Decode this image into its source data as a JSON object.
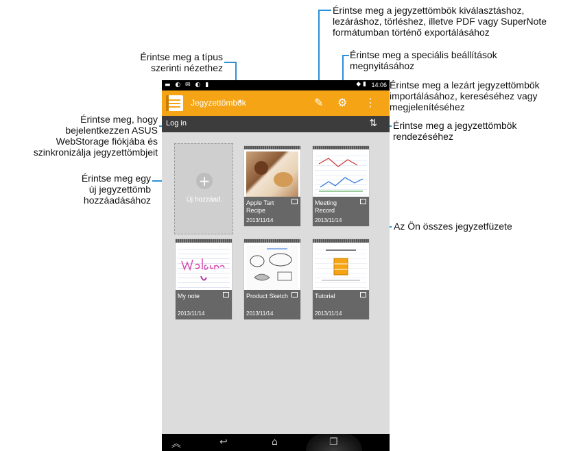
{
  "annotations": {
    "select": [
      "Érintse meg a jegyzettömbök kiválasztáshoz,",
      "lezáráshoz, törléshez, illetve PDF vagy SuperNote",
      "formátumban történő exportálásához"
    ],
    "settings": [
      "Érintse meg a speciális beállítások",
      "megnyitásához"
    ],
    "type_view": [
      "Érintse meg a típus",
      "szerinti nézethez"
    ],
    "locked": [
      "Érintse meg a lezárt jegyzettömbök",
      "importálásához, kereséséhez vagy",
      "megjelenítéséhez"
    ],
    "sort": [
      "Érintse meg a jegyzettömbök",
      "rendezéséhez"
    ],
    "login": [
      "Érintse meg, hogy",
      "bejelentkezzen ASUS",
      "WebStorage fiókjába és",
      "szinkronizálja jegyzettömbjeit"
    ],
    "add": [
      "Érintse meg egy",
      "új jegyzettömb",
      "hozzáadásához"
    ],
    "all": [
      "Az Ön összes jegyzetfüzete"
    ]
  },
  "device": {
    "status_time": "14:06",
    "view_title": "Jegyzettömbök",
    "login_label": "Log in",
    "add_label": "Új hozzáad.",
    "notebooks": [
      {
        "title": "Apple Tart Recipe",
        "date": "2013/11/14"
      },
      {
        "title": "Meeting Record",
        "date": "2013/11/14"
      },
      {
        "title": "My note",
        "date": "2013/11/14"
      },
      {
        "title": "Product Sketch",
        "date": "2013/11/14"
      },
      {
        "title": "Tutorial",
        "date": "2013/11/14"
      }
    ]
  },
  "colors": {
    "accent": "#f5a415",
    "callout": "#2a8fd6"
  }
}
